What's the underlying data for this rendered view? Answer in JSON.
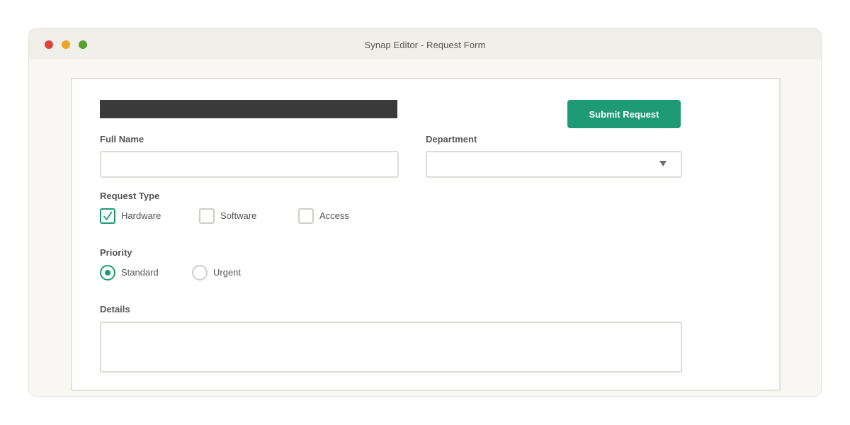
{
  "window": {
    "title": "Synap Editor - Request Form"
  },
  "form": {
    "submit_label": "Submit Request",
    "full_name": {
      "label": "Full Name",
      "value": "",
      "placeholder": ""
    },
    "department": {
      "label": "Department",
      "selected": ""
    },
    "request_type": {
      "label": "Request Type",
      "options": [
        {
          "label": "Hardware",
          "checked": true
        },
        {
          "label": "Software",
          "checked": false
        },
        {
          "label": "Access",
          "checked": false
        }
      ]
    },
    "priority": {
      "label": "Priority",
      "options": [
        {
          "label": "Standard",
          "selected": true
        },
        {
          "label": "Urgent",
          "selected": false
        }
      ]
    },
    "details": {
      "label": "Details",
      "value": ""
    }
  },
  "colors": {
    "accent": "#1e9b74",
    "redaction": "#3a3a3a"
  }
}
